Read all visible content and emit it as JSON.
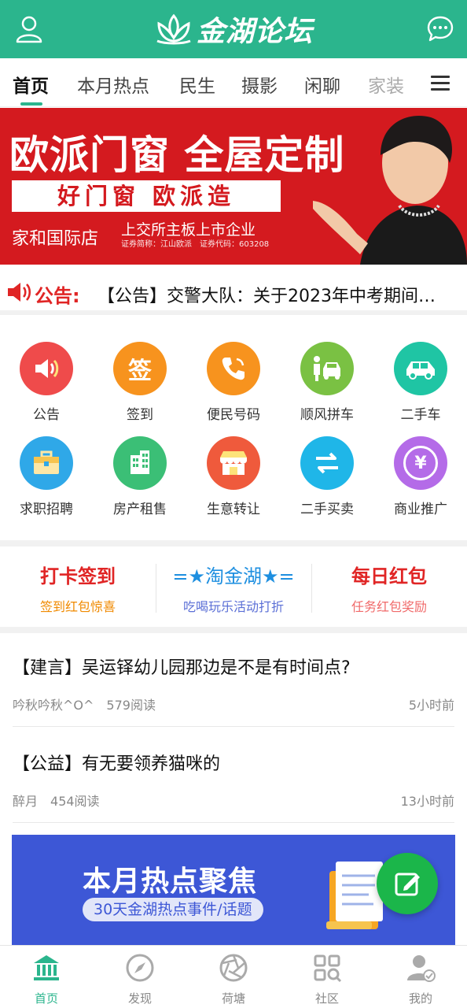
{
  "header": {
    "logo_text": "金湖论坛"
  },
  "tabs": [
    {
      "label": "首页"
    },
    {
      "label": "本月热点"
    },
    {
      "label": "民生"
    },
    {
      "label": "摄影"
    },
    {
      "label": "闲聊"
    },
    {
      "label": "家装"
    }
  ],
  "banner": {
    "headline": "欧派门窗 全屋定制",
    "slogan": "好门窗 欧派造",
    "store": "家和国际店",
    "listed": "上交所主板上市企业",
    "stock_code": "证券简称：江山欧派　证券代码：603208"
  },
  "notice": {
    "label": "公告:",
    "text": "【公告】交警大队：关于2023年中考期间…"
  },
  "grid": [
    {
      "label": "公告",
      "icon": "megaphone-icon",
      "color": "#ef4b4b"
    },
    {
      "label": "签到",
      "icon": "sign-in-icon",
      "color": "#f7931e",
      "glyph": "签"
    },
    {
      "label": "便民号码",
      "icon": "phone-icon",
      "color": "#f7931e"
    },
    {
      "label": "顺风拼车",
      "icon": "carpool-icon",
      "color": "#7ac143"
    },
    {
      "label": "二手车",
      "icon": "car-icon",
      "color": "#1fc5a4"
    },
    {
      "label": "求职招聘",
      "icon": "briefcase-icon",
      "color": "#2fa8e8"
    },
    {
      "label": "房产租售",
      "icon": "building-icon",
      "color": "#3bbf76"
    },
    {
      "label": "生意转让",
      "icon": "shop-icon",
      "color": "#ef5a3c"
    },
    {
      "label": "二手买卖",
      "icon": "swap-icon",
      "color": "#1fb6e8"
    },
    {
      "label": "商业推广",
      "icon": "yen-icon",
      "color": "#b46be8",
      "glyph": "¥"
    }
  ],
  "promo": [
    {
      "title": "打卡签到",
      "sub": "签到红包惊喜",
      "title_color": "#e02525",
      "sub_color": "#f08a00"
    },
    {
      "title": "=★淘金湖★=",
      "sub": "吃喝玩乐活动打折",
      "title_color": "#1e8fe0",
      "sub_color": "#5b6fd6"
    },
    {
      "title": "每日红包",
      "sub": "任务红包奖励",
      "title_color": "#e02525",
      "sub_color": "#f06a6a"
    }
  ],
  "posts": [
    {
      "title": "【建言】吴运铎幼儿园那边是不是有时间点?",
      "author": "吟秋吟秋^O^",
      "views": "579阅读",
      "time": "5小时前"
    },
    {
      "title": "【公益】有无要领养猫咪的",
      "author": "醉月",
      "views": "454阅读",
      "time": "13小时前"
    }
  ],
  "hot_banner": {
    "title": "本月热点聚焦",
    "subtitle": "30天金湖热点事件/话题"
  },
  "bottom_nav": [
    {
      "label": "首页",
      "icon": "bank-icon"
    },
    {
      "label": "发现",
      "icon": "compass-icon"
    },
    {
      "label": "荷塘",
      "icon": "aperture-icon"
    },
    {
      "label": "社区",
      "icon": "grid-search-icon"
    },
    {
      "label": "我的",
      "icon": "profile-icon"
    }
  ],
  "colors": {
    "brand": "#2bb58d",
    "banner_red": "#d41a1f",
    "fab": "#1bb64a"
  }
}
